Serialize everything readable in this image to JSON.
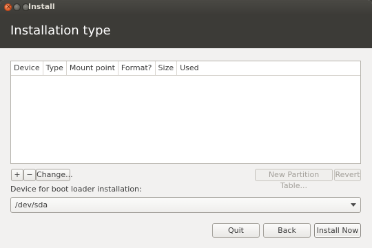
{
  "window": {
    "title": "Install"
  },
  "header": {
    "title": "Installation type"
  },
  "table": {
    "columns": [
      "Device",
      "Type",
      "Mount point",
      "Format?",
      "Size",
      "Used"
    ]
  },
  "toolbar": {
    "add_label": "+",
    "remove_label": "−",
    "change_label": "Change...",
    "new_partition_table_label": "New Partition Table...",
    "revert_label": "Revert"
  },
  "bootloader": {
    "label": "Device for boot loader installation:",
    "value": "/dev/sda"
  },
  "footer": {
    "quit_label": "Quit",
    "back_label": "Back",
    "install_label": "Install Now"
  },
  "colors": {
    "accent": "#e35b22",
    "header_bg": "#3c3b37",
    "window_bg": "#f2f1f0"
  }
}
